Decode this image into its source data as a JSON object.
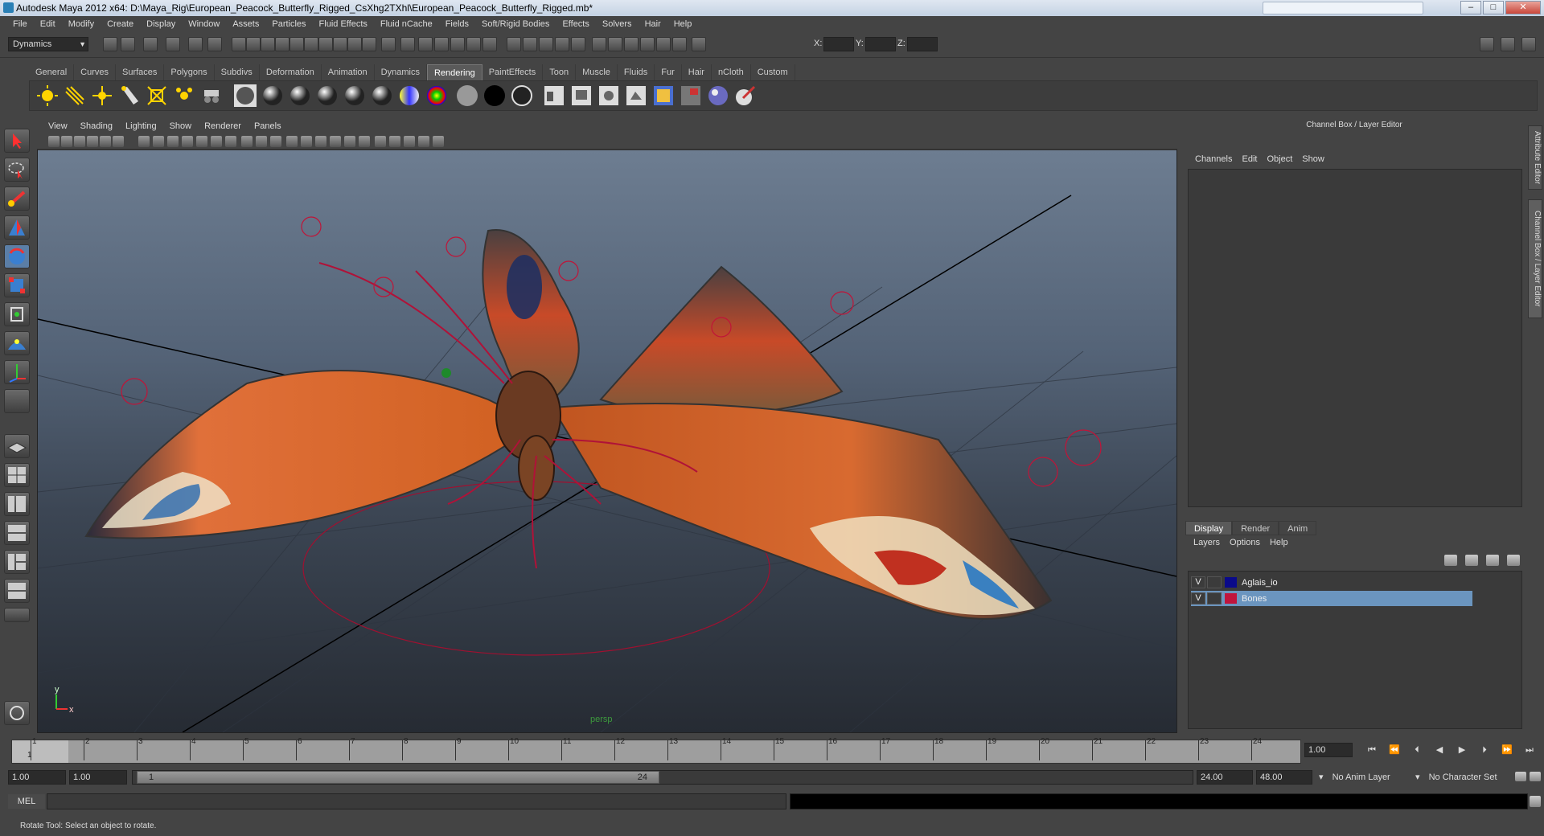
{
  "window": {
    "title": "Autodesk Maya 2012 x64: D:\\Maya_Rig\\European_Peacock_Butterfly_Rigged_CsXhg2TXhl\\European_Peacock_Butterfly_Rigged.mb*",
    "minimize": "–",
    "maximize": "□",
    "close": "✕"
  },
  "menus": [
    "File",
    "Edit",
    "Modify",
    "Create",
    "Display",
    "Window",
    "Assets",
    "Particles",
    "Fluid Effects",
    "Fluid nCache",
    "Fields",
    "Soft/Rigid Bodies",
    "Effects",
    "Solvers",
    "Hair",
    "Help"
  ],
  "status_line": {
    "mode": "Dynamics",
    "x_label": "X:",
    "y_label": "Y:",
    "z_label": "Z:"
  },
  "shelf_tabs": [
    "General",
    "Curves",
    "Surfaces",
    "Polygons",
    "Subdivs",
    "Deformation",
    "Animation",
    "Dynamics",
    "Rendering",
    "PaintEffects",
    "Toon",
    "Muscle",
    "Fluids",
    "Fur",
    "Hair",
    "nCloth",
    "Custom"
  ],
  "active_shelf": "Rendering",
  "viewport": {
    "menus": [
      "View",
      "Shading",
      "Lighting",
      "Show",
      "Renderer",
      "Panels"
    ],
    "camera": "persp",
    "axis_y": "y",
    "axis_x": "x"
  },
  "channel_box": {
    "title": "Channel Box / Layer Editor",
    "menus": [
      "Channels",
      "Edit",
      "Object",
      "Show"
    ],
    "side_tabs": [
      "Attribute Editor",
      "Channel Box / Layer Editor"
    ]
  },
  "layer_editor": {
    "tabs": [
      "Display",
      "Render",
      "Anim"
    ],
    "active_tab": "Display",
    "menus": [
      "Layers",
      "Options",
      "Help"
    ],
    "layers": [
      {
        "vis": "V",
        "name": "Aglais_io",
        "color": "#0a0a8a",
        "selected": false
      },
      {
        "vis": "V",
        "name": "Bones",
        "color": "#c0143c",
        "selected": true
      }
    ]
  },
  "time_slider": {
    "ticks": [
      "1",
      "2",
      "3",
      "4",
      "5",
      "6",
      "7",
      "8",
      "9",
      "10",
      "11",
      "12",
      "13",
      "14",
      "15",
      "16",
      "17",
      "18",
      "19",
      "20",
      "21",
      "22",
      "23",
      "24"
    ],
    "current_marker": "1",
    "current_frame": "1.00"
  },
  "playback": [
    "⏮",
    "⏪",
    "⏴",
    "◀",
    "▶",
    "⏵",
    "⏩",
    "⏭"
  ],
  "range_slider": {
    "start_time": "1.00",
    "playback_start": "1.00",
    "knob_start": "1",
    "knob_end": "24",
    "playback_end": "24.00",
    "end_time": "48.00",
    "anim_layer": "No Anim Layer",
    "character_set": "No Character Set"
  },
  "command_line": {
    "label": "MEL"
  },
  "help_line": "Rotate Tool: Select an object to rotate.",
  "colors": {
    "accent": "#6b95bf",
    "bone_color": "#c0143c",
    "panel": "#444444"
  }
}
